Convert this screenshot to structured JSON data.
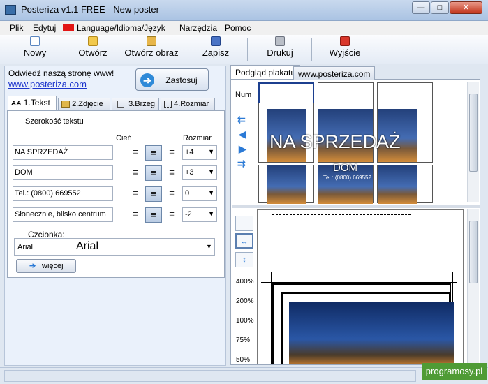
{
  "window": {
    "title": "Posteriza v1.1 FREE - New poster",
    "min": "—",
    "max": "□",
    "close": "✕"
  },
  "menu": [
    "Plik",
    "Edytuj",
    "Language/Idioma/Język",
    "Narzędzia",
    "Pomoc"
  ],
  "toolbar": {
    "new": "Nowy",
    "open": "Otwórz",
    "open_image": "Otwórz obraz",
    "save": "Zapisz",
    "print": "Drukuj",
    "exit": "Wyjście"
  },
  "left": {
    "visit": "Odwiedź naszą stronę www!",
    "link": "www.posteriza.com",
    "apply": "Zastosuj",
    "apply_icon": "➔",
    "tabs": [
      "1.Tekst",
      "2.Zdjęcie",
      "3.Brzeg",
      "4.Rozmiar"
    ],
    "tab_icon_text": "AA",
    "text_width_label": "Szerokość tekstu",
    "shadow_label": "Cień",
    "size_label": "Rozmiar",
    "rows": [
      {
        "text": "NA SPRZEDAŻ",
        "size": "+4"
      },
      {
        "text": "DOM",
        "size": "+3"
      },
      {
        "text": "Tel.: (0800) 669552",
        "size": "0"
      },
      {
        "text": "Słonecznie, blisko centrum",
        "size": "-2"
      }
    ],
    "font_label": "Czcionka:",
    "font_name": "Arial",
    "font_preview": "Arial",
    "more": "więcej"
  },
  "right": {
    "tabs": [
      "Podgląd plakatu",
      "www.posteriza.com"
    ],
    "num_label": "Num",
    "poster_title": "NA SPRZEDAŻ",
    "poster_sub": "DOM",
    "poster_tel": "Tel.: (0800) 669552",
    "zoom": [
      "400%",
      "200%",
      "100%",
      "75%",
      "50%"
    ]
  },
  "watermark": "programosy.pl",
  "colors": {
    "accent": "#2b7ad6",
    "link": "#1d35cc",
    "close": "#c2341b",
    "watermark": "#4f9b35"
  }
}
